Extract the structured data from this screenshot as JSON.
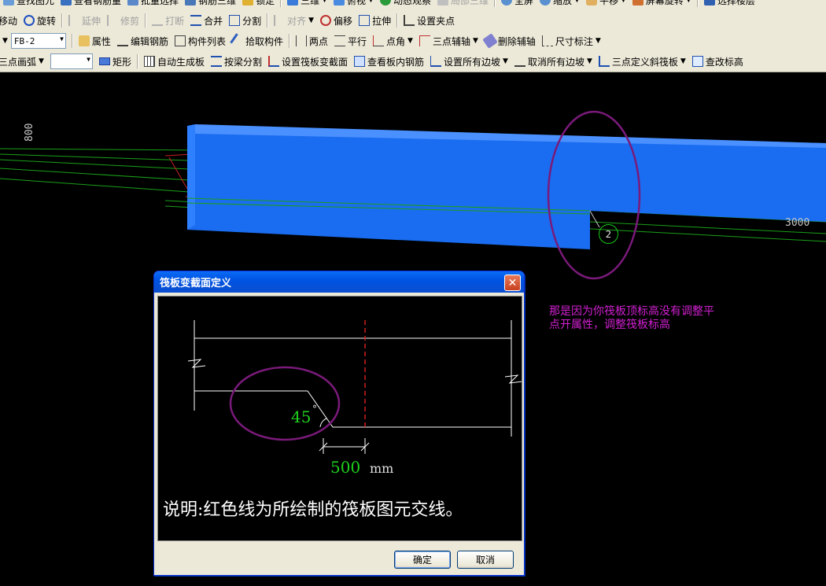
{
  "toolbar": {
    "row0": [
      "查找图元",
      "查看钢筋量",
      "批量选择",
      "钢筋三维",
      "锁定",
      "三维",
      "俯视",
      "动态观察",
      "局部三维",
      "全屏",
      "缩放",
      "平移",
      "屏幕旋转",
      "选择楼层"
    ],
    "row1": {
      "move": "移动",
      "rotate": "旋转",
      "extend": "延伸",
      "trim": "修剪",
      "break": "打断",
      "merge": "合并",
      "split": "分割",
      "align": "对齐",
      "offset": "偏移",
      "stretch": "拉伸",
      "set_grip": "设置夹点"
    },
    "row2": {
      "combo_value": "FB-2",
      "properties": "属性",
      "edit_rebar": "编辑钢筋",
      "component_list": "构件列表",
      "pick_component": "拾取构件",
      "two_points": "两点",
      "parallel": "平行",
      "point_angle": "点角",
      "three_point_axis": "三点辅轴",
      "delete_axis": "删除辅轴",
      "dimension": "尺寸标注"
    },
    "row3": {
      "arc": "三点画弧",
      "combo_value": "",
      "rectangle": "矩形",
      "auto_generate": "自动生成板",
      "split_by_beam": "按梁分割",
      "set_section": "设置筏板变截面",
      "view_rebar": "查看板内钢筋",
      "set_all_slopes": "设置所有边坡",
      "cancel_all_slopes": "取消所有边坡",
      "three_point_slope": "三点定义斜筏板",
      "check_elevation": "查改标高"
    }
  },
  "viewport": {
    "dim_left": "800",
    "dim_right": "3000",
    "marker_number": "2",
    "annotation_line1": "那是因为你筏板顶标高没有调整平",
    "annotation_line2": "点开属性，调整筏板标高",
    "slab_color": "#1a6cf0",
    "annotation_color": "#d020d0",
    "highlight_color": "#7a1a7a"
  },
  "dialog": {
    "title": "筏板变截面定义",
    "close_symbol": "✕",
    "angle_value": "45",
    "degree_symbol": "°",
    "length_value": "500",
    "length_unit": "mm",
    "description": "说明:红色线为所绘制的筏板图元交线。",
    "ok_label": "确定",
    "cancel_label": "取消"
  }
}
